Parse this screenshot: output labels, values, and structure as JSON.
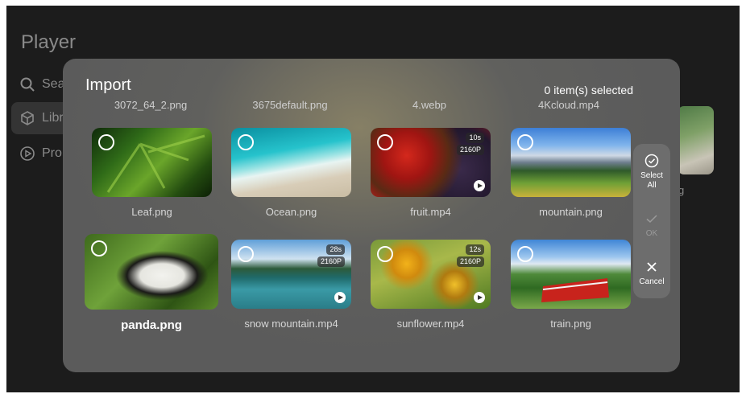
{
  "app": {
    "title": "Player",
    "sidebar": [
      {
        "label": "Sea",
        "icon": "search-icon"
      },
      {
        "label": "Libr",
        "icon": "library-cube-icon"
      },
      {
        "label": "Pro",
        "icon": "play-circle-icon"
      }
    ],
    "bg_label": "g"
  },
  "dialog": {
    "title": "Import",
    "selected_count": "0 item(s) selected",
    "top_names": [
      "3072_64_2.png",
      "3675default.png",
      "4.webp",
      "4Kcloud.mp4"
    ],
    "items": [
      {
        "name": "Leaf.png",
        "type": "image"
      },
      {
        "name": "Ocean.png",
        "type": "image"
      },
      {
        "name": "fruit.mp4",
        "type": "video",
        "duration": "10s",
        "resolution": "2160P"
      },
      {
        "name": "mountain.png",
        "type": "image"
      },
      {
        "name": "panda.png",
        "type": "image",
        "focused": true
      },
      {
        "name": "snow mountain.mp4",
        "type": "video",
        "duration": "28s",
        "resolution": "2160P"
      },
      {
        "name": "sunflower.mp4",
        "type": "video",
        "duration": "12s",
        "resolution": "2160P"
      },
      {
        "name": "train.png",
        "type": "image"
      }
    ]
  },
  "actions": {
    "select_all": "Select All",
    "ok": "OK",
    "cancel": "Cancel"
  }
}
